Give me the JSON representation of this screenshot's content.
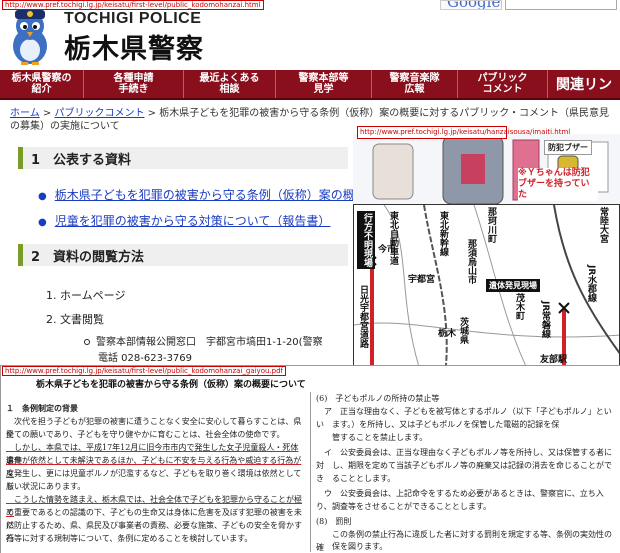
{
  "header": {
    "url": "http://www.pref.tochigi.lg.jp/keisatu/first-level/public_kodomohanzai.html",
    "logo_en": "TOCHIGI POLICE",
    "logo_jp": "栃木県警察",
    "search_brand": "Google"
  },
  "nav": {
    "items": [
      {
        "label": "栃木県警察の\n紹介",
        "width": 84
      },
      {
        "label": "各種申請\n手続き",
        "width": 100
      },
      {
        "label": "最近よくある\n相談",
        "width": 92
      },
      {
        "label": "警察本部等\n見学",
        "width": 96
      },
      {
        "label": "警察音楽隊\n広報",
        "width": 86
      },
      {
        "label": "パブリック\nコメント",
        "width": 90
      }
    ],
    "cut_item": "関連リン"
  },
  "breadcrumb": {
    "home": "ホーム",
    "sep": ">",
    "public_comment": "パブリックコメント",
    "current": "> 栃木県子どもを犯罪の被害から守る条例（仮称）案の概要に対するパブリック・コメント（県民意見の募集）の実施について"
  },
  "section1": {
    "title": "1　公表する資料",
    "links": [
      "栃木県子どもを犯罪の被害から守る条例（仮称）案の概要",
      "児童を犯罪の被害から守る対策について（報告書）"
    ]
  },
  "section2": {
    "title": "2　資料の閲覧方法",
    "items": [
      "1.  ホームページ",
      "2.  文書閲覧"
    ],
    "office": "警察本部情報公開窓口　宇都宮市塙田1-1-20(警察",
    "phone": "電話 028-623-3769"
  },
  "illustration": {
    "url": "http://www.pref.tochigi.lg.jp/keisatu/hanzaisousa/imaiti.html",
    "buzzer_label": "防犯ブザー",
    "note": "※Ｙちゃんは防犯ブザーを持っていた"
  },
  "map": {
    "lost_label": "行方不明現場",
    "found_label": "遺体発見現場",
    "labels": [
      "今市",
      "東北自動車道",
      "東北新幹線",
      "那須烏山市",
      "那珂川町",
      "茂木町",
      "栃木",
      "茨城県",
      "宇都宮",
      "友部駅",
      "水戸",
      "JR常磐線",
      "JR水郡線",
      "常陸大宮",
      "日光宇都宮道路"
    ]
  },
  "document": {
    "url": "http://www.pref.tochigi.lg.jp/keisatu/first-level/public_kodomohanzai_gaiyou.pdf",
    "title": "栃木県子どもを犯罪の被害から守る条例（仮称）案の概要について",
    "left": [
      "１　条例制定の背景",
      "　次代を担う子どもが犯罪の被害に遭うことなく安全に安心して暮らすことは、県民",
      "全ての願いであり、子どもを守り健やかに育むことは、社会全体の使命です。",
      "　しかし、本県では、平成17年12月に旧今市市内で発生した女子児童殺人・死体遺棄",
      "事件が依然として未解決であるほか、子どもに不安を与える行為や威迫する行為が度",
      "々発生し、更には児童ポルノが氾濫するなど、子どもを取り巻く環境は依然として厳",
      "しい状況にあります。",
      "　こうした情勢を踏まえ、栃木県では、社会全体で子どもを犯罪から守ることが極め",
      "て重要であるとの認識の下、子どもの生命又は身体に危害を及ぼす犯罪の被害を未然",
      "に防止するため、県、県民及び事業者の責務、必要な施策、子どもの安全を脅かす行",
      "為等に対する規制等について、条例に定めることを検討しています。"
    ],
    "right": [
      "(6)　子どもポルノの所持の禁止等",
      "　ア　正当な理由なく、子どもを被写体とするポルノ（以下「子どもポルノ」といい",
      "　　ます。）を所持し、又は子どもポルノを保管した電磁的記録を保",
      "　　管することを禁止します。",
      "　イ　公安委員会は、正当な理由なく子どもポルノ等を所持し、又は保管する者に対",
      "　　し、期限を定めて当該子どもポルノ等の廃棄又は記録の消去を命じることができ",
      "　　ることとします。",
      "　ウ　公安委員会は、上記命令をするため必要があるときは、警察官に、立ち入り、",
      "　　調査等をさせることができることとします。",
      "(8)　罰則",
      "　　この条例の禁止行為に違反した者に対する罰則を規定する等、条例の実効性の確",
      "　　保を図ります。"
    ]
  }
}
